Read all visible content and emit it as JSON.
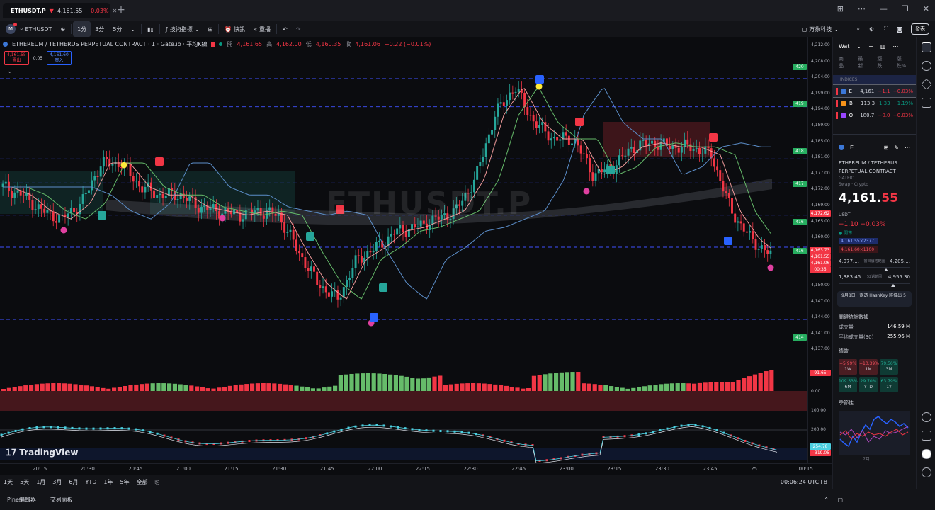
{
  "tab": {
    "symbol": "ETHUSDT.P",
    "direction": "▼",
    "price": "4,161.55",
    "change_pct": "−0.03%"
  },
  "toolbar": {
    "symbol": "ETHUSDT",
    "interval_1": "1分",
    "interval_2": "3分",
    "interval_3": "5分",
    "indicators": "技術指標",
    "alerts": "快訊",
    "replay": "重播",
    "account": "万象科技",
    "publish": "發表"
  },
  "legend": {
    "title": "ETHEREUM / TETHERUS PERPETUAL CONTRACT · 1 · Gate.io · 平均K線",
    "o_label": "開",
    "o": "4,161.65",
    "h_label": "高",
    "h": "4,162.00",
    "l_label": "低",
    "l": "4,160.35",
    "c_label": "收",
    "c": "4,161.06",
    "chg": "−0.22 (−0.01%)",
    "sell_price": "4,161.55",
    "sell_label": "賣出",
    "spread": "0.05",
    "buy_price": "4,161.60",
    "buy_label": "買入"
  },
  "watermark": "ETHUSDT.P",
  "brand": "TradingView",
  "price_axis": [
    "4,212.00",
    "4,208.00",
    "4,204.00",
    "4,199.00",
    "4,194.00",
    "4,189.00",
    "4,185.00",
    "4,181.00",
    "4,177.00",
    "4,172.00",
    "4,169.00",
    "4,165.00",
    "4,160.00",
    "4,156.00",
    "4,153.00",
    "4,150.00",
    "4,147.00",
    "4,144.00",
    "4,141.00",
    "4,137.00"
  ],
  "lower_axis": [
    "0.00",
    "100.00",
    "200.00"
  ],
  "tags": {
    "t1": "420",
    "t2": "419",
    "t3": "418",
    "t4": "417",
    "t5": "416",
    "t6": "416",
    "last_price": "4,161.55",
    "current": "4,161.06",
    "mark": "4,163.73",
    "countdown": "00:35",
    "alt": "4,172.62",
    "low": "414",
    "vol": "91.65",
    "osc1": "254.78",
    "osc2": "−319.05"
  },
  "time_axis": [
    "20:15",
    "20:30",
    "20:45",
    "21:00",
    "21:15",
    "21:30",
    "21:45",
    "22:00",
    "22:15",
    "22:30",
    "22:45",
    "23:00",
    "23:15",
    "23:30",
    "23:45",
    "25",
    "00:15"
  ],
  "range_bar": [
    "1天",
    "5天",
    "1月",
    "3月",
    "6月",
    "YTD",
    "1年",
    "5年",
    "全部"
  ],
  "clock": "00:06:24 UTC+8",
  "panels": [
    "Pine編輯器",
    "交易面板"
  ],
  "watchlist": {
    "title": "Wat",
    "cols": [
      "商品",
      "最新",
      "漲跌",
      "漲跌%"
    ],
    "section": "INDICES",
    "rows": [
      {
        "name": "E",
        "last": "4,161",
        "chg": "−1.1",
        "pct": "−0.03%"
      },
      {
        "name": "B",
        "last": "113,3",
        "chg": "1.33",
        "pct": "1.19%"
      },
      {
        "name": "O",
        "last": "180.7",
        "chg": "−0.0",
        "pct": "−0.03%"
      }
    ]
  },
  "details": {
    "short": "E",
    "name": "ETHEREUM / TETHERUS PERPETUAL CONTRACT",
    "exchange": "GATEIO",
    "sub": "Swap · Crypto",
    "price_main": "4,161.",
    "price_dec": "55",
    "currency": "USDT",
    "change": "−1.10  −0.03%",
    "status": "● 開市",
    "bid": "4,161.55×2377",
    "ask": "4,161.60×1100",
    "day_low": "4,077....",
    "day_label": "當日價格範圍",
    "day_high": "4,205....",
    "y_low": "1,383.45",
    "y_label": "52週範圍",
    "y_high": "4,955.30",
    "news": "9月8日 · 露透 HashKey 將推出 5 ...",
    "stats_title": "關鍵統計數據",
    "vol_label": "成交量",
    "vol": "146.59 M",
    "avg_label": "平均成交量(30)",
    "avg": "255.96 M",
    "perf_title": "績效",
    "perf": [
      {
        "v": "−5.99%",
        "p": "1W",
        "s": "neg"
      },
      {
        "v": "−10.39%",
        "p": "1M",
        "s": "neg"
      },
      {
        "v": "79.56%",
        "p": "3M",
        "s": "pos"
      },
      {
        "v": "109.53%",
        "p": "6M",
        "s": "pos"
      },
      {
        "v": "29.70%",
        "p": "YTD",
        "s": "pos"
      },
      {
        "v": "63.79%",
        "p": "1Y",
        "s": "pos"
      }
    ],
    "season_title": "季節性",
    "season_month": "7月"
  },
  "colors": {
    "up": "#26a69a",
    "down": "#f23645",
    "accent": "#2962ff",
    "dashed": "#3f51ff"
  },
  "chart_data": {
    "type": "candlestick",
    "price_samples": [
      4178,
      4176,
      4172,
      4170,
      4174,
      4184,
      4184,
      4178,
      4176,
      4176,
      4173,
      4172,
      4171,
      4172,
      4171,
      4162,
      4154,
      4150,
      4160,
      4163,
      4167,
      4168,
      4170,
      4172,
      4180,
      4196,
      4203,
      4194,
      4190,
      4190,
      4181,
      4183,
      4188,
      4189,
      4188,
      4188,
      4186,
      4172,
      4165,
      4161
    ],
    "dashed_levels": [
      4205,
      4198,
      4185,
      4179,
      4171,
      4163,
      4145
    ]
  }
}
